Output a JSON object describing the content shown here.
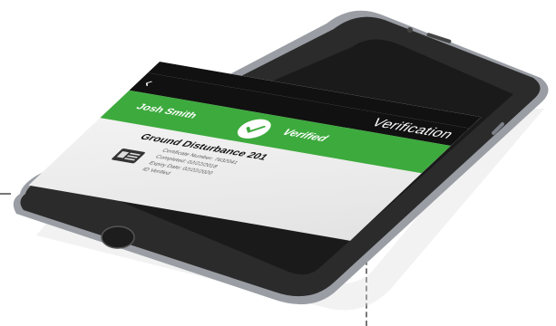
{
  "header": {
    "back_icon": "chevron-left-icon",
    "title": "Verification"
  },
  "verification": {
    "name": "Josh Smith",
    "status": "Verified",
    "status_icon": "check-circle-icon",
    "accent_color": "#3daa3d"
  },
  "certificate": {
    "title": "Ground Disturbance 201",
    "number_text": "Certificate Number: 7632041",
    "completed_text": "Completed: 02/22/2018",
    "expiry_text": "Expiry Date: 02/22/2020",
    "id_status_text": "ID Verified",
    "id_icon": "id-card-icon"
  }
}
